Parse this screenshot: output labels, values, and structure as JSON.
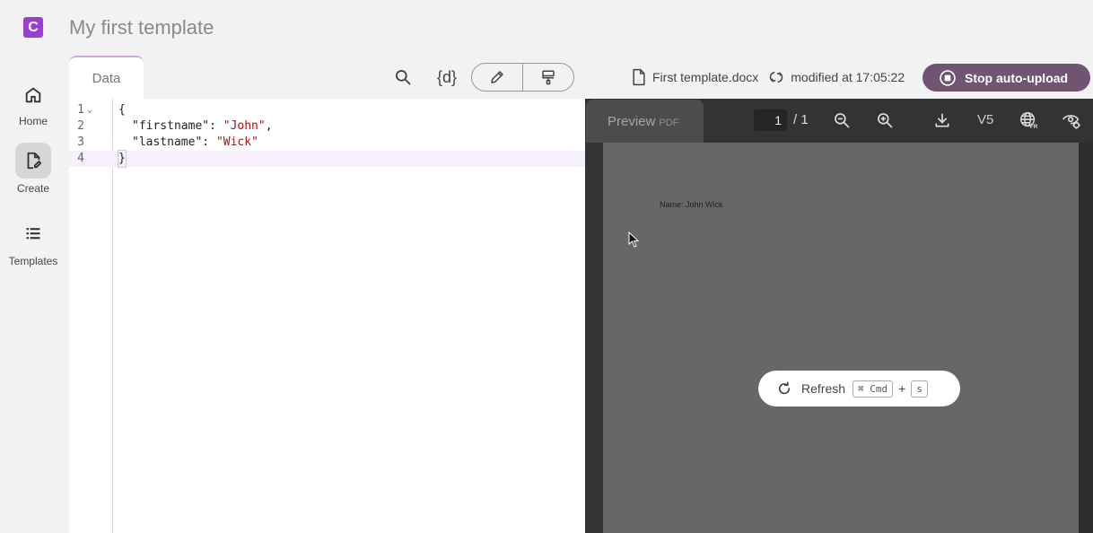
{
  "app": {
    "logo_letter": "C",
    "title": "My first template"
  },
  "sidebar": {
    "items": [
      {
        "label": "Home",
        "icon": "home-icon"
      },
      {
        "label": "Create",
        "icon": "create-icon",
        "active": true
      },
      {
        "label": "Templates",
        "icon": "list-icon"
      }
    ]
  },
  "editor": {
    "tab_label": "Data",
    "lines": [
      {
        "n": "1",
        "text": "{"
      },
      {
        "n": "2",
        "key": "\"firstname\"",
        "value": "\"John\""
      },
      {
        "n": "3",
        "key": "\"lastname\"",
        "value": "\"Wick\""
      },
      {
        "n": "4",
        "text": "}"
      }
    ],
    "toolbar": {
      "format_label": "{d}"
    }
  },
  "file": {
    "name": "First template.docx",
    "modified": "modified at 17:05:22"
  },
  "upload": {
    "stop_label": "Stop auto-upload"
  },
  "preview": {
    "tab_label": "Preview",
    "tab_format": "PDF",
    "page_current": "1",
    "page_total": "/ 1",
    "version": "V5",
    "content_text": "Name: John Wick"
  },
  "refresh": {
    "label": "Refresh",
    "key_cmd": "⌘ Cmd",
    "plus": "+",
    "key_s": "s"
  },
  "colors": {
    "accent": "#9b3fd0",
    "stop_button": "#6f5571",
    "preview_bg": "#323334"
  }
}
